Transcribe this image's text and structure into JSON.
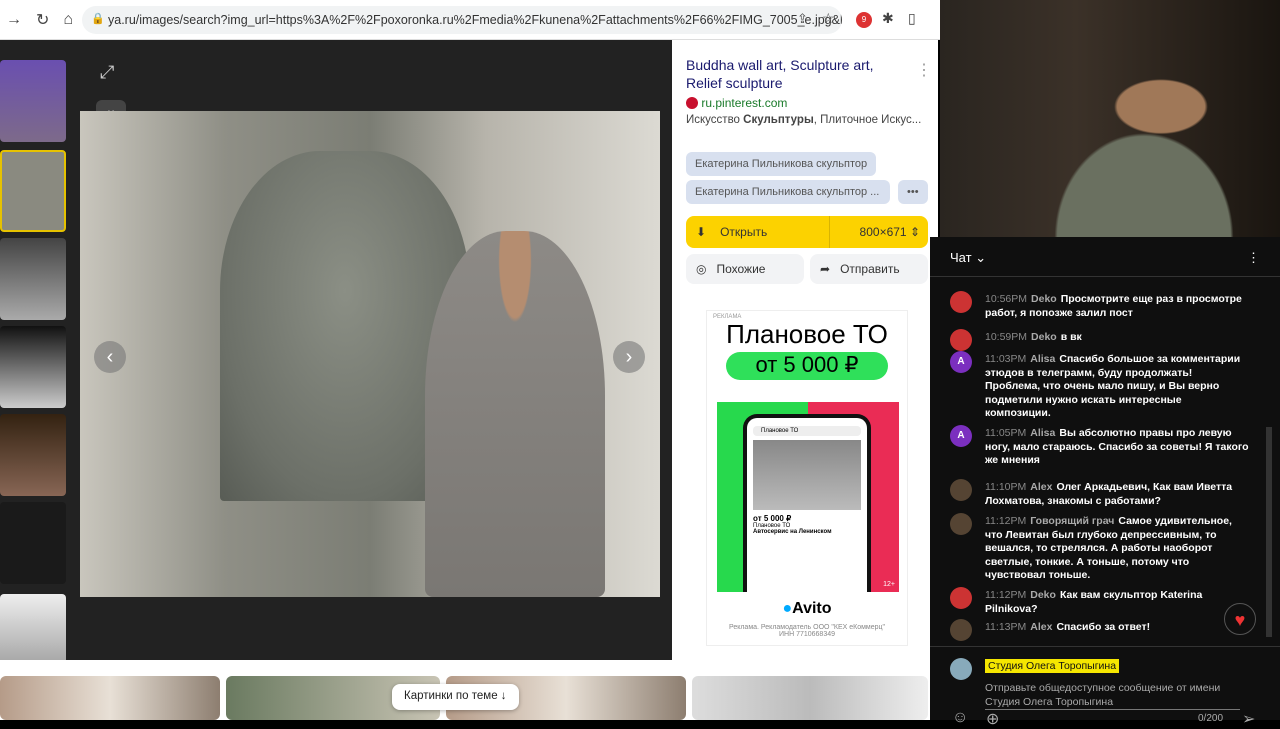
{
  "browser": {
    "url": "ya.ru/images/search?img_url=https%3A%2F%2Fpoxoronka.ru%2Fmedia%2Fkunena%2Fattachments%2F66%2FIMG_7005_e.jpg&l...",
    "ext_badge": "9"
  },
  "panel": {
    "title": "Buddha wall art, Sculpture art, Relief sculpture",
    "source": "ru.pinterest.com",
    "desc_pre": "Искусство ",
    "desc_bold": "Скульптуры",
    "desc_post": ", Плиточное Искус...",
    "tags": [
      "Екатерина Пильникова скульптор",
      "Екатерина Пильникова скульптор ...",
      "•••"
    ],
    "open_label": "Открыть",
    "size": "800×671",
    "similar_label": "Похожие",
    "share_label": "Отправить",
    "ad": {
      "label": "РЕКЛАМА",
      "headline": "Плановое ТО",
      "price": "от 5 000 ₽",
      "phone_search": "Плановое ТО",
      "phone_price": "от 5 000 ₽",
      "phone_title": "Плановое ТО",
      "phone_seller": "Автосервис на Ленинском",
      "age": "12+",
      "brand": "Avito",
      "footer": "Реклама. Рекламодатель ООО \"КЕХ еКоммерц\" ИНН 7710668349"
    }
  },
  "bottom": {
    "related_label": "Картинки по теме ↓"
  },
  "chat": {
    "title": "Чат",
    "messages": [
      {
        "time": "10:56PM",
        "author": "Deko",
        "text": "Просмотрите еще раз в просмотре работ, я попозже залил пост"
      },
      {
        "time": "10:59PM",
        "author": "Deko",
        "text": "в вк"
      },
      {
        "time": "11:03PM",
        "author": "Alisa",
        "text": "Спасибо большое за комментарии этюдов в телеграмм, буду продолжать! Проблема, что очень мало пишу, и Вы верно подметили нужно искать интересные композиции."
      },
      {
        "time": "11:05PM",
        "author": "Alisa",
        "text": "Вы абсолютно правы про левую ногу, мало стараюсь. Спасибо за советы! Я такого же мнения"
      },
      {
        "time": "11:10PM",
        "author": "Alex",
        "text": "Олег Аркадьевич, Как вам Иветта Лохматова, знакомы с работами?"
      },
      {
        "time": "11:12PM",
        "author": "Говорящий грач",
        "text": "Самое удивительное, что Левитан был глубоко депрессивным, то вешался, то стрелялся. А работы наоборот светлые, тонкие. А тоньше, потому что чувствовал тоньше."
      },
      {
        "time": "11:12PM",
        "author": "Deko",
        "text": "Как вам скульптор Katerina Pilnikova?"
      },
      {
        "time": "11:13PM",
        "author": "Alex",
        "text": "Спасибо за ответ!"
      }
    ],
    "avatar_letter": "A",
    "channel": "Студия Олега Торопыгина",
    "placeholder": "Отправьте общедоступное сообщение от имени Студия Олега Торопыгина",
    "counter": "0/200"
  }
}
